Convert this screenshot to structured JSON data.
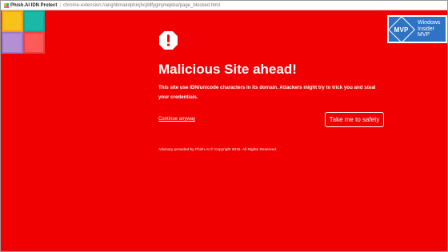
{
  "addressbar": {
    "app_name": "Phish.AI IDN Protect",
    "separator": "|",
    "url": "chrome-extension://anghbmakdphinjhcjbllfygmjmejkba/page_blocked.html"
  },
  "logo": {
    "icon": "tile-grid-logo",
    "colors": [
      "#f7c21a",
      "#19b9a7",
      "#b58fd3",
      "#ff5a5a"
    ]
  },
  "badge": {
    "logo_text": "MVP",
    "line1": "Windows",
    "line2": "Insider",
    "line3": "MVP",
    "color": "#2f73c4"
  },
  "warning": {
    "icon": "alert-octagon-icon",
    "title": "Malicious Site ahead!",
    "description": "This site use IDN/unicode characters in its domain. Attackers might try to trick you and steal your credentials.",
    "continue_label": "Continue anyway",
    "safety_label": "Take me to safety",
    "footer": "Advisory provided by Phish.AI © Copyright 2018. All Rights Reserved."
  },
  "colors": {
    "background": "#f00000",
    "text": "#ffffff"
  }
}
